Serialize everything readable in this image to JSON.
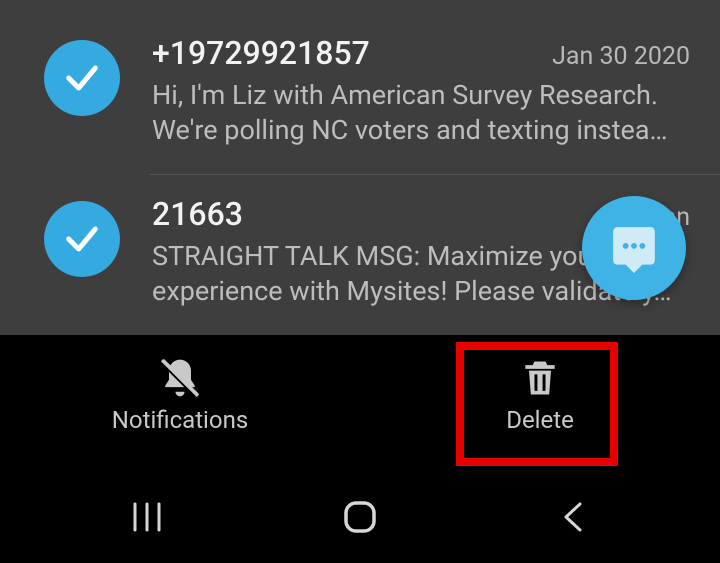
{
  "conversations": [
    {
      "sender": "+19729921857",
      "date": "Jan 30 2020",
      "preview": "Hi, I'm Liz with American Survey Research. We're polling NC voters and texting instea…"
    },
    {
      "sender": "21663",
      "date": "Jan",
      "preview": "STRAIGHT TALK MSG: Maximize your experience with Mysites! Please validate y…"
    }
  ],
  "actions": {
    "notifications": "Notifications",
    "delete": "Delete"
  }
}
